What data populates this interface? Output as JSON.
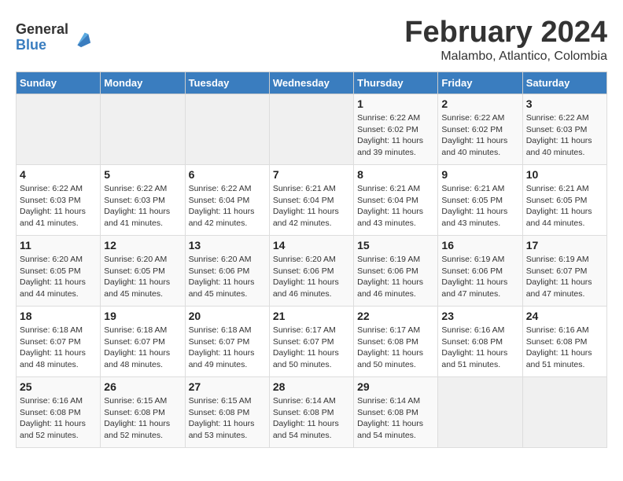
{
  "logo": {
    "general": "General",
    "blue": "Blue"
  },
  "title": "February 2024",
  "subtitle": "Malambo, Atlantico, Colombia",
  "days_header": [
    "Sunday",
    "Monday",
    "Tuesday",
    "Wednesday",
    "Thursday",
    "Friday",
    "Saturday"
  ],
  "weeks": [
    [
      {
        "day": "",
        "info": ""
      },
      {
        "day": "",
        "info": ""
      },
      {
        "day": "",
        "info": ""
      },
      {
        "day": "",
        "info": ""
      },
      {
        "day": "1",
        "info": "Sunrise: 6:22 AM\nSunset: 6:02 PM\nDaylight: 11 hours\nand 39 minutes."
      },
      {
        "day": "2",
        "info": "Sunrise: 6:22 AM\nSunset: 6:02 PM\nDaylight: 11 hours\nand 40 minutes."
      },
      {
        "day": "3",
        "info": "Sunrise: 6:22 AM\nSunset: 6:03 PM\nDaylight: 11 hours\nand 40 minutes."
      }
    ],
    [
      {
        "day": "4",
        "info": "Sunrise: 6:22 AM\nSunset: 6:03 PM\nDaylight: 11 hours\nand 41 minutes."
      },
      {
        "day": "5",
        "info": "Sunrise: 6:22 AM\nSunset: 6:03 PM\nDaylight: 11 hours\nand 41 minutes."
      },
      {
        "day": "6",
        "info": "Sunrise: 6:22 AM\nSunset: 6:04 PM\nDaylight: 11 hours\nand 42 minutes."
      },
      {
        "day": "7",
        "info": "Sunrise: 6:21 AM\nSunset: 6:04 PM\nDaylight: 11 hours\nand 42 minutes."
      },
      {
        "day": "8",
        "info": "Sunrise: 6:21 AM\nSunset: 6:04 PM\nDaylight: 11 hours\nand 43 minutes."
      },
      {
        "day": "9",
        "info": "Sunrise: 6:21 AM\nSunset: 6:05 PM\nDaylight: 11 hours\nand 43 minutes."
      },
      {
        "day": "10",
        "info": "Sunrise: 6:21 AM\nSunset: 6:05 PM\nDaylight: 11 hours\nand 44 minutes."
      }
    ],
    [
      {
        "day": "11",
        "info": "Sunrise: 6:20 AM\nSunset: 6:05 PM\nDaylight: 11 hours\nand 44 minutes."
      },
      {
        "day": "12",
        "info": "Sunrise: 6:20 AM\nSunset: 6:05 PM\nDaylight: 11 hours\nand 45 minutes."
      },
      {
        "day": "13",
        "info": "Sunrise: 6:20 AM\nSunset: 6:06 PM\nDaylight: 11 hours\nand 45 minutes."
      },
      {
        "day": "14",
        "info": "Sunrise: 6:20 AM\nSunset: 6:06 PM\nDaylight: 11 hours\nand 46 minutes."
      },
      {
        "day": "15",
        "info": "Sunrise: 6:19 AM\nSunset: 6:06 PM\nDaylight: 11 hours\nand 46 minutes."
      },
      {
        "day": "16",
        "info": "Sunrise: 6:19 AM\nSunset: 6:06 PM\nDaylight: 11 hours\nand 47 minutes."
      },
      {
        "day": "17",
        "info": "Sunrise: 6:19 AM\nSunset: 6:07 PM\nDaylight: 11 hours\nand 47 minutes."
      }
    ],
    [
      {
        "day": "18",
        "info": "Sunrise: 6:18 AM\nSunset: 6:07 PM\nDaylight: 11 hours\nand 48 minutes."
      },
      {
        "day": "19",
        "info": "Sunrise: 6:18 AM\nSunset: 6:07 PM\nDaylight: 11 hours\nand 48 minutes."
      },
      {
        "day": "20",
        "info": "Sunrise: 6:18 AM\nSunset: 6:07 PM\nDaylight: 11 hours\nand 49 minutes."
      },
      {
        "day": "21",
        "info": "Sunrise: 6:17 AM\nSunset: 6:07 PM\nDaylight: 11 hours\nand 50 minutes."
      },
      {
        "day": "22",
        "info": "Sunrise: 6:17 AM\nSunset: 6:08 PM\nDaylight: 11 hours\nand 50 minutes."
      },
      {
        "day": "23",
        "info": "Sunrise: 6:16 AM\nSunset: 6:08 PM\nDaylight: 11 hours\nand 51 minutes."
      },
      {
        "day": "24",
        "info": "Sunrise: 6:16 AM\nSunset: 6:08 PM\nDaylight: 11 hours\nand 51 minutes."
      }
    ],
    [
      {
        "day": "25",
        "info": "Sunrise: 6:16 AM\nSunset: 6:08 PM\nDaylight: 11 hours\nand 52 minutes."
      },
      {
        "day": "26",
        "info": "Sunrise: 6:15 AM\nSunset: 6:08 PM\nDaylight: 11 hours\nand 52 minutes."
      },
      {
        "day": "27",
        "info": "Sunrise: 6:15 AM\nSunset: 6:08 PM\nDaylight: 11 hours\nand 53 minutes."
      },
      {
        "day": "28",
        "info": "Sunrise: 6:14 AM\nSunset: 6:08 PM\nDaylight: 11 hours\nand 54 minutes."
      },
      {
        "day": "29",
        "info": "Sunrise: 6:14 AM\nSunset: 6:08 PM\nDaylight: 11 hours\nand 54 minutes."
      },
      {
        "day": "",
        "info": ""
      },
      {
        "day": "",
        "info": ""
      }
    ]
  ]
}
